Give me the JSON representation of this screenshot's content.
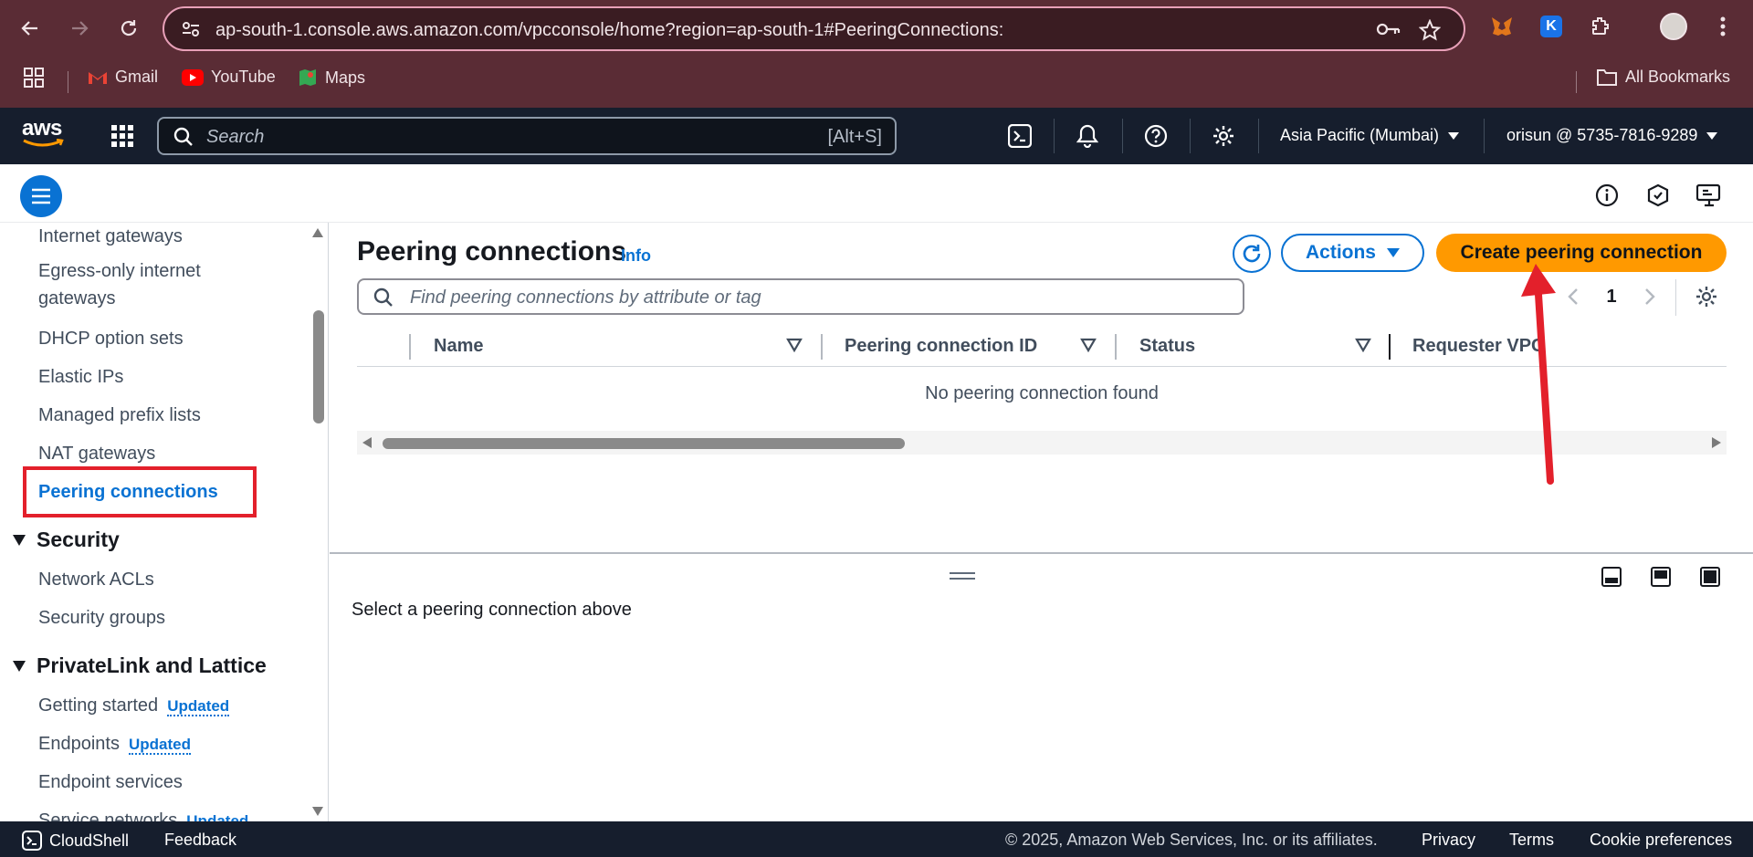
{
  "browser": {
    "url": "ap-south-1.console.aws.amazon.com/vpcconsole/home?region=ap-south-1#PeeringConnections:",
    "bookmarks": [
      "Gmail",
      "YouTube",
      "Maps"
    ],
    "all_bookmarks": "All Bookmarks",
    "extension_k_label": "K"
  },
  "aws_nav": {
    "logo": "aws",
    "search_placeholder": "Search",
    "search_shortcut": "[Alt+S]",
    "region": "Asia Pacific (Mumbai)",
    "account": "orisun @ 5735-7816-9289"
  },
  "sidebar": {
    "items_top": [
      "Internet gateways",
      "Egress-only internet gateways",
      "DHCP option sets",
      "Elastic IPs",
      "Managed prefix lists",
      "NAT gateways",
      "Peering connections"
    ],
    "section_security": "Security",
    "security_items": [
      "Network ACLs",
      "Security groups"
    ],
    "section_privatelink": "PrivateLink and Lattice",
    "privatelink_items": [
      {
        "label": "Getting started",
        "badge": "Updated"
      },
      {
        "label": "Endpoints",
        "badge": "Updated"
      },
      {
        "label": "Endpoint services",
        "badge": ""
      },
      {
        "label": "Service networks",
        "badge": "Updated"
      }
    ]
  },
  "main": {
    "title": "Peering connections",
    "info": "Info",
    "actions_label": "Actions",
    "create_label": "Create peering connection",
    "filter_placeholder": "Find peering connections by attribute or tag",
    "page_number": "1",
    "columns": [
      "Name",
      "Peering connection ID",
      "Status",
      "Requester VPC"
    ],
    "empty_message": "No peering connection found",
    "detail_message": "Select a peering connection above"
  },
  "footer": {
    "cloudshell": "CloudShell",
    "feedback": "Feedback",
    "copyright": "© 2025, Amazon Web Services, Inc. or its affiliates.",
    "privacy": "Privacy",
    "terms": "Terms",
    "cookies": "Cookie preferences"
  },
  "colors": {
    "chrome_bg": "#5a2c35",
    "aws_nav_bg": "#161e2d",
    "primary_blue": "#0972d3",
    "create_orange": "#ff9900",
    "annotation_red": "#e3202b"
  },
  "icons": [
    "back-icon",
    "forward-icon",
    "reload-icon",
    "site-settings-icon",
    "key-icon",
    "star-icon",
    "extensions-icon",
    "profile-icon",
    "menu-dots-icon",
    "apps-grid-icon",
    "folder-icon",
    "grid-menu-icon",
    "search-icon",
    "cloudshell-icon",
    "bell-icon",
    "help-icon",
    "gear-icon",
    "info-circle-icon",
    "notifications-shield-icon",
    "feedback-screen-icon",
    "refresh-icon",
    "caret-down-icon",
    "chevron-left-icon",
    "chevron-right-icon",
    "sort-icon",
    "panel-bottom-icon",
    "panel-side-icon",
    "panel-off-icon"
  ]
}
